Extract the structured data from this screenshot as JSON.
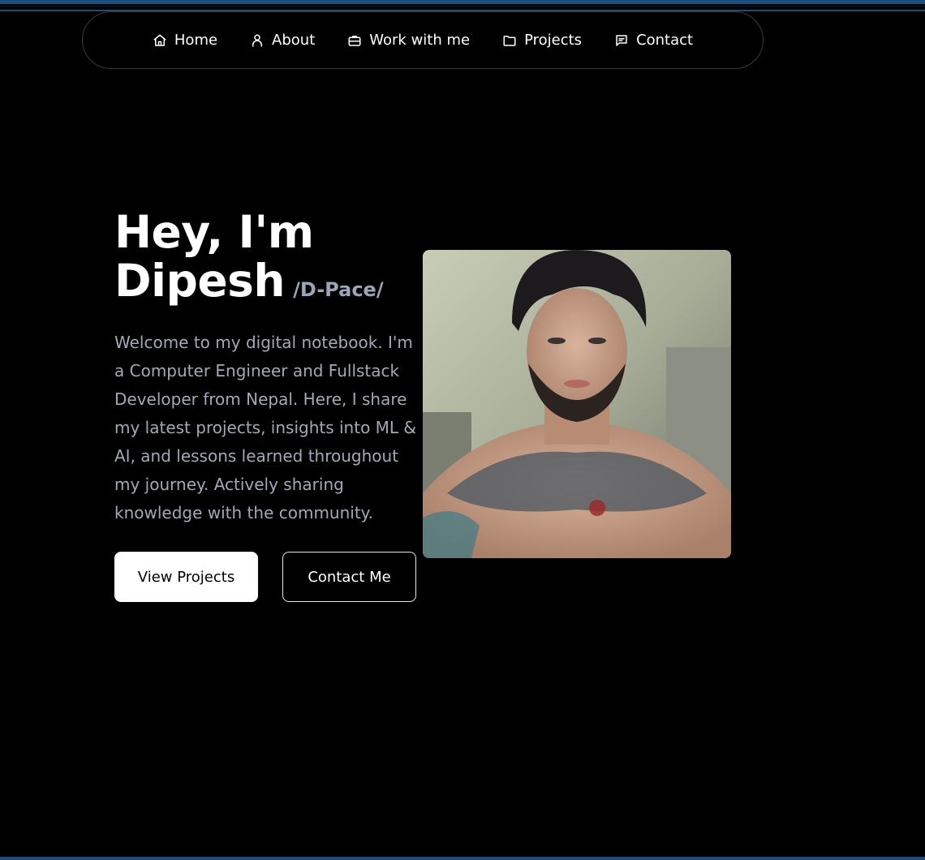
{
  "nav": {
    "items": [
      {
        "label": "Home",
        "icon": "home-icon"
      },
      {
        "label": "About",
        "icon": "user-icon"
      },
      {
        "label": "Work with me",
        "icon": "briefcase-icon"
      },
      {
        "label": "Projects",
        "icon": "folder-icon"
      },
      {
        "label": "Contact",
        "icon": "message-icon"
      }
    ]
  },
  "hero": {
    "title_line1": "Hey, I'm",
    "title_line2": "Dipesh",
    "pronunciation": "/D-Pace/",
    "description": "Welcome to my digital notebook. I'm a Computer Engineer and Fullstack Developer from Nepal. Here, I share my latest projects, insights into ML & AI, and lessons learned throughout my journey. Actively sharing knowledge with the community.",
    "primary_button": "View Projects",
    "secondary_button": "Contact Me"
  },
  "colors": {
    "background": "#000000",
    "accent_strip": "#1e4d7b",
    "muted_text": "#a0aab7",
    "pronunciation": "#9aa6b6"
  }
}
